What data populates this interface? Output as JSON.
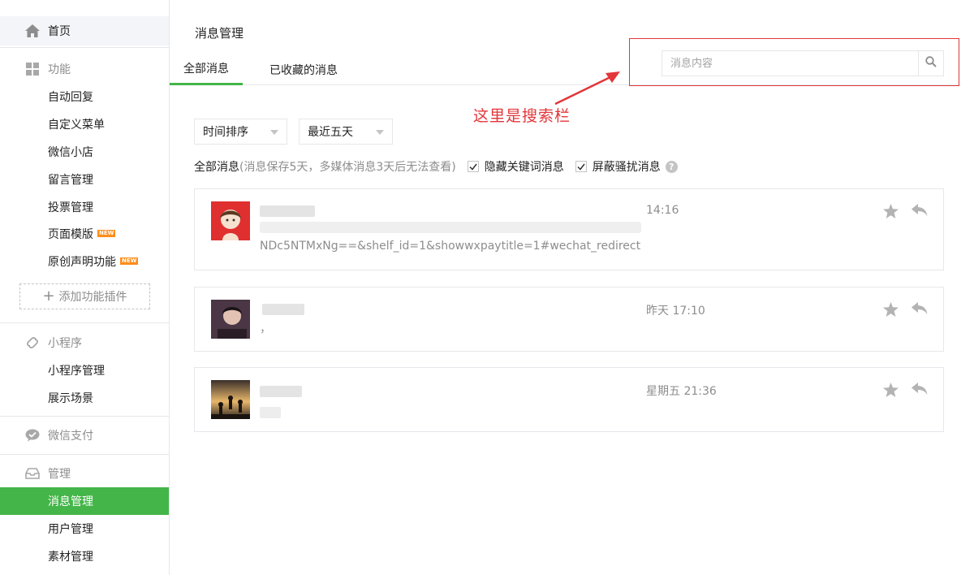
{
  "sidebar": {
    "home": "首页",
    "features": {
      "title": "功能",
      "items": [
        "自动回复",
        "自定义菜单",
        "微信小店",
        "留言管理",
        "投票管理",
        "页面模版",
        "原创声明功能"
      ],
      "new_badge": "NEW",
      "add_plugin": "添加功能插件"
    },
    "miniprogram": {
      "title": "小程序",
      "items": [
        "小程序管理",
        "展示场景"
      ]
    },
    "wechat_pay": "微信支付",
    "manage": {
      "title": "管理",
      "items": [
        "消息管理",
        "用户管理",
        "素材管理"
      ]
    }
  },
  "main": {
    "page_title": "消息管理",
    "tabs": [
      "全部消息",
      "已收藏的消息"
    ],
    "search": {
      "placeholder": "消息内容"
    },
    "annotation": "这里是搜索栏",
    "sort_dropdown": "时间排序",
    "range_dropdown": "最近五天",
    "info_label": "全部消息",
    "info_note": "(消息保存5天，多媒体消息3天后无法查看)",
    "checkbox_hide_keyword": "隐藏关键词消息",
    "checkbox_block_spam": "屏蔽骚扰消息",
    "help": "?"
  },
  "messages": [
    {
      "time": "14:16",
      "content": "NDc5NTMxNg==&shelf_id=1&showwxpaytitle=1#wechat_redirect"
    },
    {
      "time": "昨天 17:10",
      "content": "，"
    },
    {
      "time": "星期五 21:36",
      "content": ""
    }
  ],
  "colors": {
    "accent": "#44b549",
    "annotation": "#e2363a",
    "badge": "#ff8d1a"
  },
  "icons": {
    "home": "home-icon",
    "features": "grid-icon",
    "miniprogram": "link-icon",
    "pay": "wechat-pay-icon",
    "manage": "inbox-icon",
    "search": "search-icon",
    "star": "star-icon",
    "reply": "reply-icon"
  }
}
